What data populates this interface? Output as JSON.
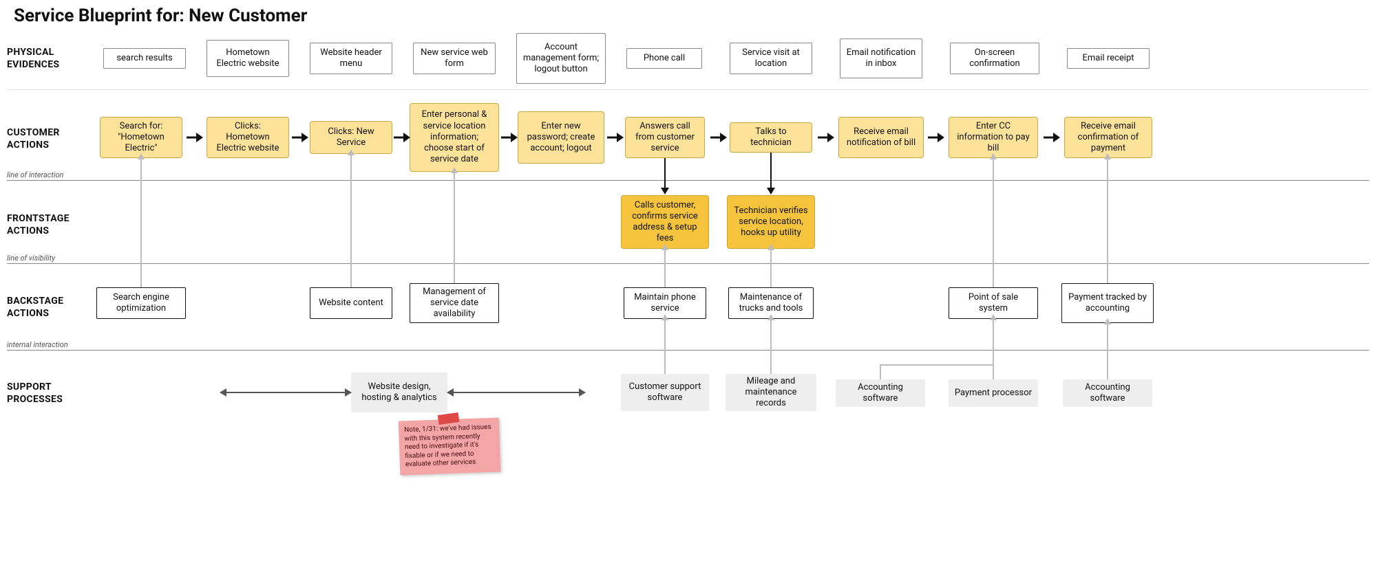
{
  "title": "Service Blueprint for: New Customer",
  "row_labels": {
    "physical": "PHYSICAL\nEVIDENCES",
    "customer": "CUSTOMER\nACTIONS",
    "frontstage": "FRONTSTAGE\nACTIONS",
    "backstage": "BACKSTAGE\nACTIONS",
    "support": "SUPPORT\nPROCESSES"
  },
  "lines": {
    "interaction": "line of interaction",
    "visibility": "line of visibility",
    "internal": "internal interaction"
  },
  "physical": [
    "search results",
    "Hometown Electric website",
    "Website header menu",
    "New service web form",
    "Account management form; logout button",
    "Phone call",
    "Service visit at location",
    "Email notification in inbox",
    "On-screen confirmation",
    "Email receipt"
  ],
  "customer": [
    "Search for: \"Hometown Electric\"",
    "Clicks: Hometown Electric website",
    "Clicks: New Service",
    "Enter personal & service location information; choose start of service date",
    "Enter new password; create account; logout",
    "Answers call from customer service",
    "Talks to technician",
    "Receive email notification of bill",
    "Enter CC information to pay bill",
    "Receive email confirmation of payment"
  ],
  "frontstage": [
    "Calls customer, confirms service address & setup fees",
    "Technician verifies service location, hooks up utility"
  ],
  "backstage": {
    "b0": "Search engine optimization",
    "b2": "Website content",
    "b3": "Management of service date availability",
    "b5": "Maintain phone service",
    "b6": "Maintenance of trucks and tools",
    "b8": "Point of sale system",
    "b9": "Payment tracked by accounting"
  },
  "support": {
    "s_web": "Website design, hosting & analytics",
    "s5": "Customer support software",
    "s6": "Mileage and maintenance records",
    "s7": "Accounting software",
    "s8": "Payment processor",
    "s9": "Accounting software"
  },
  "note": "Note, 1/31: we've had issues with this system recently need to investigate if it's fixable or if we need to evaluate other services"
}
